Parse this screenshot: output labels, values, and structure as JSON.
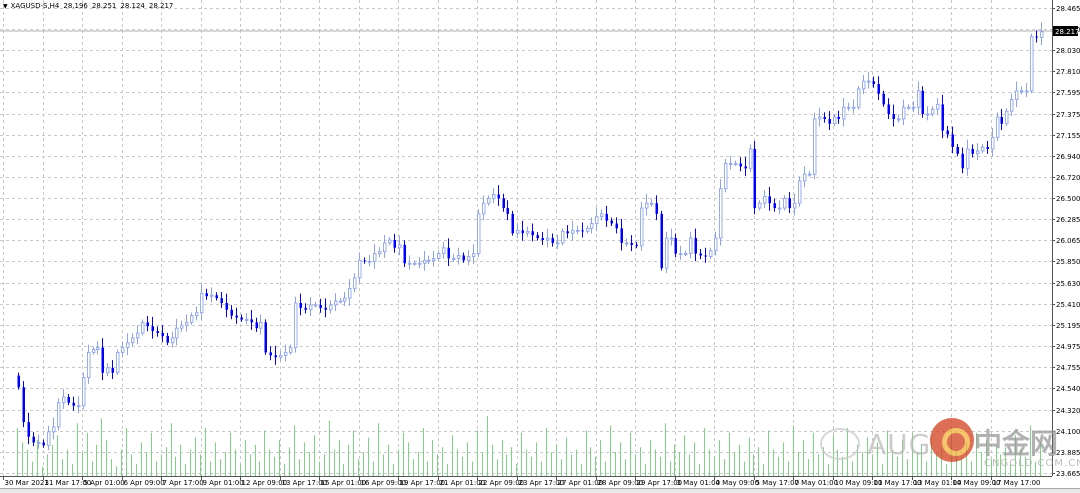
{
  "header": {
    "symbol": "XAGUSD-S,H4",
    "open": "28.196",
    "high": "28.251",
    "low": "28.124",
    "close": "28.217"
  },
  "current_price_label": "28.217",
  "colors": {
    "bull_outline": "#8ea3ee",
    "bear_fill": "#0000ff",
    "volume": "#7ed37e",
    "grid": "#c8c8c8",
    "last_bar": "#33dd33"
  },
  "chart_data": {
    "type": "candlestick",
    "title": "XAGUSD-S,H4",
    "ylim": [
      23.665,
      28.465
    ],
    "price_ticks": [
      "28.465",
      "28.250",
      "28.030",
      "27.810",
      "27.595",
      "27.375",
      "27.155",
      "26.940",
      "26.720",
      "26.500",
      "26.285",
      "26.065",
      "25.850",
      "25.630",
      "25.410",
      "25.195",
      "24.975",
      "24.755",
      "24.540",
      "24.320",
      "24.100",
      "23.885",
      "23.665"
    ],
    "time_ticks": [
      "30 Mar 2021",
      "31 Mar 17:00",
      "5 Apr 01:00",
      "6 Apr 09:00",
      "7 Apr 17:00",
      "9 Apr 01:00",
      "12 Apr 09:00",
      "13 Apr 17:00",
      "15 Apr 01:00",
      "16 Apr 09:00",
      "19 Apr 17:00",
      "21 Apr 01:00",
      "22 Apr 09:00",
      "23 Apr 17:00",
      "27 Apr 01:00",
      "28 Apr 09:00",
      "29 Apr 17:00",
      "3 May 01:00",
      "4 May 09:00",
      "5 May 17:00",
      "7 May 01:00",
      "10 May 09:00",
      "11 May 17:00",
      "13 May 01:00",
      "14 May 09:00",
      "17 May 17:00"
    ],
    "closes": [
      24.55,
      24.19,
      24.04,
      23.98,
      23.98,
      23.95,
      24.09,
      24.14,
      24.39,
      24.45,
      24.39,
      24.36,
      24.36,
      24.65,
      24.91,
      24.94,
      24.96,
      24.7,
      24.75,
      24.7,
      24.91,
      24.96,
      25.01,
      25.06,
      25.11,
      25.22,
      25.18,
      25.13,
      25.11,
      25.08,
      25.01,
      25.06,
      25.16,
      25.19,
      25.22,
      25.29,
      25.32,
      25.52,
      25.49,
      25.5,
      25.47,
      25.42,
      25.35,
      25.29,
      25.27,
      25.25,
      25.25,
      25.22,
      25.16,
      25.22,
      24.91,
      24.88,
      24.86,
      24.88,
      24.91,
      24.96,
      25.42,
      25.37,
      25.35,
      25.4,
      25.4,
      25.37,
      25.35,
      25.4,
      25.44,
      25.44,
      25.47,
      25.57,
      25.68,
      25.86,
      25.85,
      25.85,
      25.93,
      25.95,
      26.04,
      26.07,
      25.99,
      26.02,
      25.83,
      25.83,
      25.83,
      25.83,
      25.86,
      25.86,
      25.88,
      25.93,
      25.99,
      25.88,
      25.88,
      25.91,
      25.86,
      25.9,
      25.93,
      26.34,
      26.45,
      26.5,
      26.54,
      26.5,
      26.4,
      26.34,
      26.14,
      26.17,
      26.14,
      26.16,
      26.12,
      26.09,
      26.07,
      26.09,
      26.04,
      26.04,
      26.16,
      26.14,
      26.17,
      26.17,
      26.16,
      26.19,
      26.24,
      26.31,
      26.34,
      26.27,
      26.24,
      26.19,
      26.04,
      26.04,
      26.02,
      26.01,
      26.4,
      26.45,
      26.45,
      26.34,
      25.78,
      26.09,
      26.09,
      25.93,
      25.93,
      25.93,
      26.09,
      25.93,
      25.91,
      25.9,
      25.96,
      26.09,
      26.6,
      26.86,
      26.86,
      26.86,
      26.83,
      26.81,
      27.01,
      26.4,
      26.45,
      26.52,
      26.45,
      26.4,
      26.4,
      26.5,
      26.4,
      26.45,
      26.68,
      26.75,
      26.75,
      27.32,
      27.34,
      27.32,
      27.27,
      27.34,
      27.32,
      27.44,
      27.44,
      27.44,
      27.63,
      27.71,
      27.71,
      27.68,
      27.58,
      27.47,
      27.37,
      27.32,
      27.32,
      27.44,
      27.44,
      27.44,
      27.61,
      27.37,
      27.37,
      27.42,
      27.47,
      27.2,
      27.16,
      27.03,
      26.96,
      26.81,
      27.01,
      26.96,
      26.99,
      27.03,
      27.01,
      27.13,
      27.34,
      27.27,
      27.4,
      27.52,
      27.61,
      27.61,
      27.61,
      28.17,
      28.16,
      28.22
    ],
    "volumes": [
      40,
      28,
      22,
      12,
      30,
      8,
      18,
      26,
      34,
      14,
      22,
      10,
      44,
      20,
      36,
      12,
      26,
      48,
      30,
      14,
      8,
      22,
      40,
      18,
      10,
      28,
      20,
      36,
      12,
      18,
      24,
      44,
      16,
      26,
      10,
      22,
      32,
      18,
      40,
      12,
      28,
      14,
      20,
      36,
      22,
      10,
      30,
      18,
      26,
      12,
      38,
      22,
      16,
      30,
      10,
      24,
      42,
      14,
      28,
      20,
      34,
      12,
      18,
      46,
      22,
      30,
      10,
      26,
      38,
      14,
      20,
      32,
      12,
      44,
      18,
      26,
      10,
      22,
      36,
      28,
      14,
      20,
      40,
      12,
      30,
      18,
      24,
      10,
      34,
      22,
      16,
      28,
      12,
      38,
      20,
      50,
      26,
      14,
      30,
      18,
      24,
      10,
      36,
      22,
      16,
      28,
      12,
      40,
      20,
      26,
      14,
      32,
      18,
      22,
      10,
      38,
      24,
      16,
      30,
      12,
      42,
      20,
      28,
      14,
      36,
      18,
      24,
      10,
      30,
      22,
      16,
      44,
      12,
      26,
      20,
      34,
      18,
      28,
      10,
      40,
      22,
      16,
      30,
      14,
      36,
      20,
      26,
      12,
      32,
      18,
      24,
      10,
      38,
      22,
      16,
      28,
      12,
      42,
      20,
      30,
      14,
      36,
      18,
      24,
      10,
      34,
      22,
      16,
      40,
      12,
      26,
      20,
      32,
      18,
      28,
      10,
      38,
      22,
      16,
      30,
      14,
      36,
      20,
      26,
      12,
      32,
      18,
      24,
      10,
      40,
      22,
      16,
      28,
      12,
      36,
      20,
      30,
      14,
      26,
      18,
      24,
      10,
      34,
      22,
      16,
      42,
      12,
      28,
      20,
      14
    ]
  },
  "watermark": {
    "brand": "AUG",
    "logo_text": "中金网",
    "site": "CNGOLD.COM.CN"
  }
}
